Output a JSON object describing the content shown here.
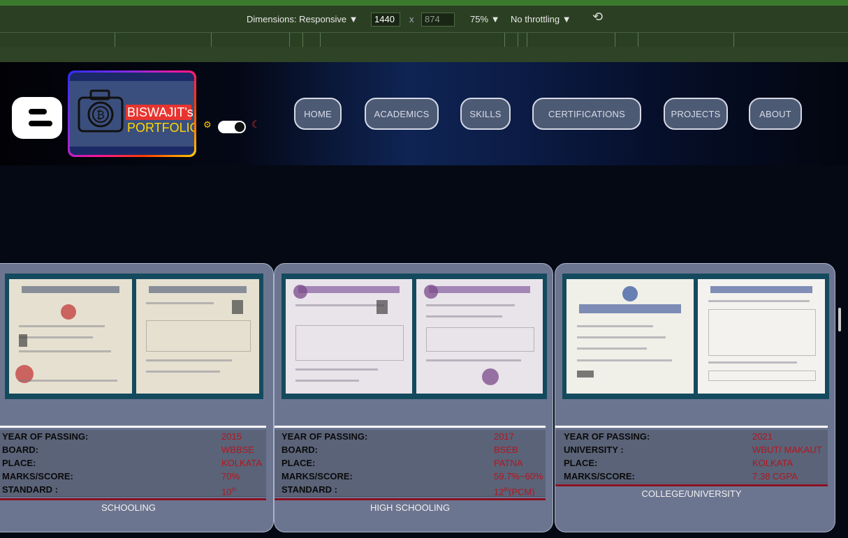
{
  "devtools": {
    "dimensions_label": "Dimensions: Responsive ▼",
    "width_value": "1440",
    "times": "x",
    "height_value": "874",
    "zoom": "75% ▼",
    "throttling": "No throttling ▼",
    "rotate_icon": "⟲"
  },
  "header": {
    "logo_line1": "BISWAJIT's",
    "logo_line2": "PORTFOLIO",
    "nav": [
      "HOME",
      "ACADEMICS",
      "SKILLS",
      "CERTIFICATIONS",
      "PROJECTS",
      "ABOUT"
    ]
  },
  "cards": [
    {
      "rows": [
        {
          "key": "YEAR OF PASSING:",
          "value": "2015"
        },
        {
          "key": "BOARD:",
          "value": "WBBSE"
        },
        {
          "key": "PLACE:",
          "value": "KOLKATA"
        },
        {
          "key": "MARKS/SCORE:",
          "value": "70%"
        },
        {
          "key": "STANDARD :",
          "value": "10",
          "sup": "th"
        }
      ],
      "caption": "SCHOOLING"
    },
    {
      "rows": [
        {
          "key": "YEAR OF PASSING:",
          "value": "2017"
        },
        {
          "key": "BOARD:",
          "value": "BSEB"
        },
        {
          "key": "PLACE:",
          "value": "PATNA"
        },
        {
          "key": "MARKS/SCORE:",
          "value": "59.7%~60%"
        },
        {
          "key": "STANDARD :",
          "value": "12",
          "sup": "th",
          "suffix": "(PCM)"
        }
      ],
      "caption": "HIGH SCHOOLING"
    },
    {
      "rows": [
        {
          "key": "YEAR OF PASSING:",
          "value": "2021"
        },
        {
          "key": "UNIVERSITY :",
          "value": "WBUT/ MAKAUT"
        },
        {
          "key": "PLACE:",
          "value": "KOLKATA"
        },
        {
          "key": "MARKS/SCORE:",
          "value": "7.38 CGPA"
        }
      ],
      "caption": "COLLEGE/UNIVERSITY"
    }
  ],
  "colors": {
    "value_red": "#b3161e",
    "card_bg": "#6c7590",
    "nav_bg": "#4d5a74"
  }
}
